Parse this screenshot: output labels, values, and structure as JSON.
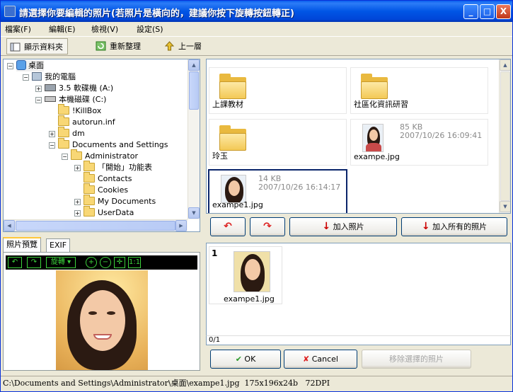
{
  "window": {
    "title": "請選擇你要編輯的照片(若照片是橫向的，建議你按下旋轉按鈕轉正)",
    "buttons": {
      "minimize": "_",
      "maximize": "□",
      "close": "X"
    }
  },
  "menu": [
    "檔案(F)",
    "編輯(E)",
    "檢視(V)",
    "設定(S)"
  ],
  "toolbar": {
    "show_folders": "顯示資料夾",
    "refresh": "重新整理",
    "up": "上一層"
  },
  "tree": {
    "desktop": "桌面",
    "my_computer": "我的電腦",
    "floppy": "3.5 軟碟機 (A:)",
    "local_disk": "本機磁碟 (C:)",
    "items": [
      "!KillBox",
      "autorun.inf",
      "dm",
      "Documents and Settings",
      "Administrator",
      "「開始」功能表",
      "Contacts",
      "Cookies",
      "My Documents",
      "UserData"
    ]
  },
  "preview": {
    "tabs": [
      "照片預覽",
      "EXIF"
    ],
    "rotate_label": "旋轉",
    "fit": "1:1"
  },
  "browser": {
    "folders": [
      "上課教材",
      "社區化資訊研習",
      "玲玉"
    ],
    "files": [
      {
        "name": "exampe.jpg",
        "size": "85 KB",
        "date": "2007/10/26 16:09:41"
      },
      {
        "name": "exampe1.jpg",
        "size": "14 KB",
        "date": "2007/10/26 16:14:17"
      }
    ]
  },
  "actions": {
    "add_photo": "加入照片",
    "add_all": "加入所有的照片"
  },
  "selected": {
    "index": "1",
    "filename": "exampe1.jpg",
    "count": "0/1"
  },
  "buttons": {
    "ok": "OK",
    "cancel": "Cancel",
    "remove": "移除選擇的照片"
  },
  "status": {
    "path": "C:\\Documents and Settings\\Administrator\\桌面\\exampe1.jpg",
    "dims": "175x196x24b",
    "dpi": "72DPI"
  },
  "colors": {
    "titlebar": "#0055E5",
    "selection_border": "#0A246A",
    "preview_tool": "#3CD33C"
  }
}
